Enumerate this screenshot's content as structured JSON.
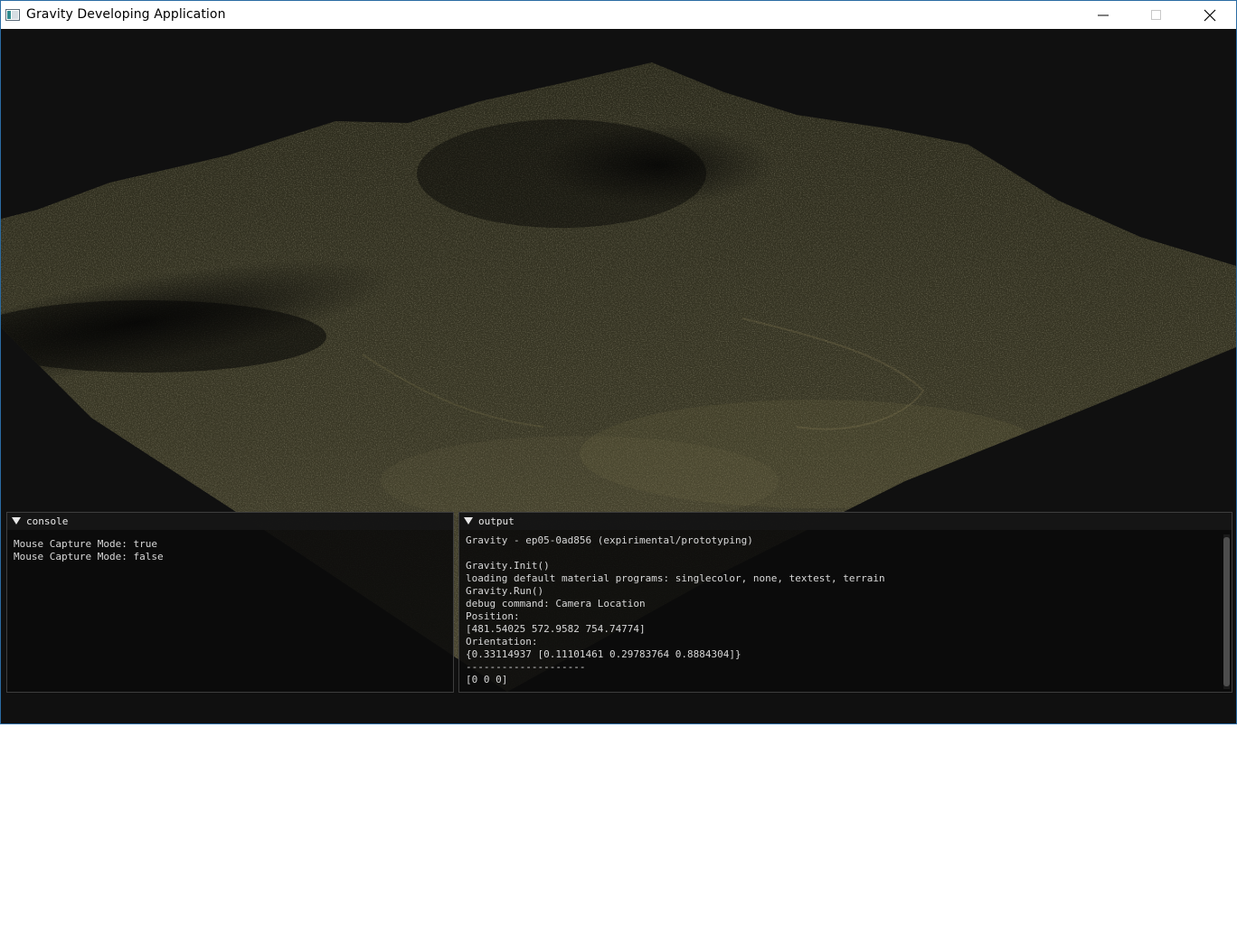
{
  "window": {
    "title": "Gravity Developing Application",
    "icon": "app-window-icon",
    "controls": [
      "minimize-icon",
      "maximize-icon",
      "close-icon"
    ]
  },
  "viewport": {
    "scene": "terrain",
    "colors": {
      "background": "#101010",
      "terrain": "#3a3826",
      "highlight": "#8a8056"
    }
  },
  "console": {
    "title": "console",
    "lines": [
      "Mouse Capture Mode: true",
      "Mouse Capture Mode: false"
    ]
  },
  "output": {
    "title": "output",
    "lines": [
      "Gravity - ep05-0ad856 (expirimental/prototyping)",
      "",
      "Gravity.Init()",
      "loading default material programs: singlecolor, none, textest, terrain",
      "Gravity.Run()",
      "debug command: Camera Location",
      "Position:",
      "[481.54025 572.9582 754.74774]",
      "Orientation:",
      "{0.33114937 [0.11101461 0.29783764 0.8884304]}",
      "--------------------",
      "[0 0 0]"
    ]
  }
}
